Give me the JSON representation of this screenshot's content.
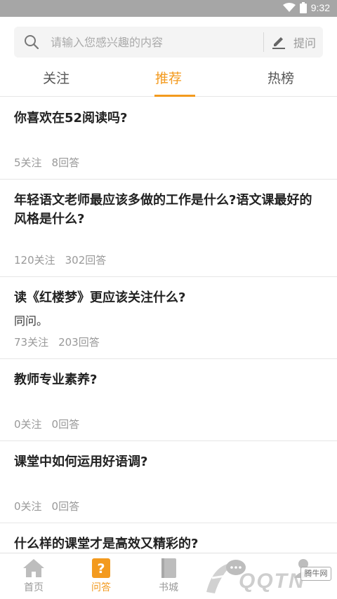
{
  "status_bar": {
    "time": "9:32",
    "wifi_icon": "wifi-icon",
    "battery_icon": "battery-icon"
  },
  "search": {
    "placeholder": "请输入您感兴趣的内容",
    "ask_label": "提问",
    "icon": "search-icon",
    "ask_icon": "pencil-icon"
  },
  "tabs": [
    {
      "label": "关注",
      "active": false
    },
    {
      "label": "推荐",
      "active": true
    },
    {
      "label": "热榜",
      "active": false
    }
  ],
  "questions": [
    {
      "title": "你喜欢在52阅读吗?",
      "desc": "",
      "follows": "5关注",
      "answers": "8回答"
    },
    {
      "title": "年轻语文老师最应该多做的工作是什么?语文课最好的风格是什么?",
      "desc": "",
      "follows": "120关注",
      "answers": "302回答"
    },
    {
      "title": "读《红楼梦》更应该关注什么?",
      "desc": "同问。",
      "follows": "73关注",
      "answers": "203回答"
    },
    {
      "title": "教师专业素养?",
      "desc": "",
      "follows": "0关注",
      "answers": "0回答"
    },
    {
      "title": "课堂中如何运用好语调?",
      "desc": "",
      "follows": "0关注",
      "answers": "0回答"
    },
    {
      "title": "什么样的课堂才是高效又精彩的?",
      "desc": "",
      "follows": "",
      "answers": ""
    }
  ],
  "bottom_nav": [
    {
      "label": "首页",
      "icon": "home-icon",
      "active": false
    },
    {
      "label": "问答",
      "icon": "question-icon",
      "active": true
    },
    {
      "label": "书城",
      "icon": "book-icon",
      "active": false
    },
    {
      "label": "",
      "icon": "chat-icon",
      "active": false
    },
    {
      "label": "",
      "icon": "profile-icon",
      "active": false
    }
  ],
  "watermark": {
    "text": "QQTN",
    "badge": "腾牛网"
  },
  "colors": {
    "accent": "#f39a1e",
    "status_bar": "#a6a6a6",
    "muted": "#999999"
  }
}
